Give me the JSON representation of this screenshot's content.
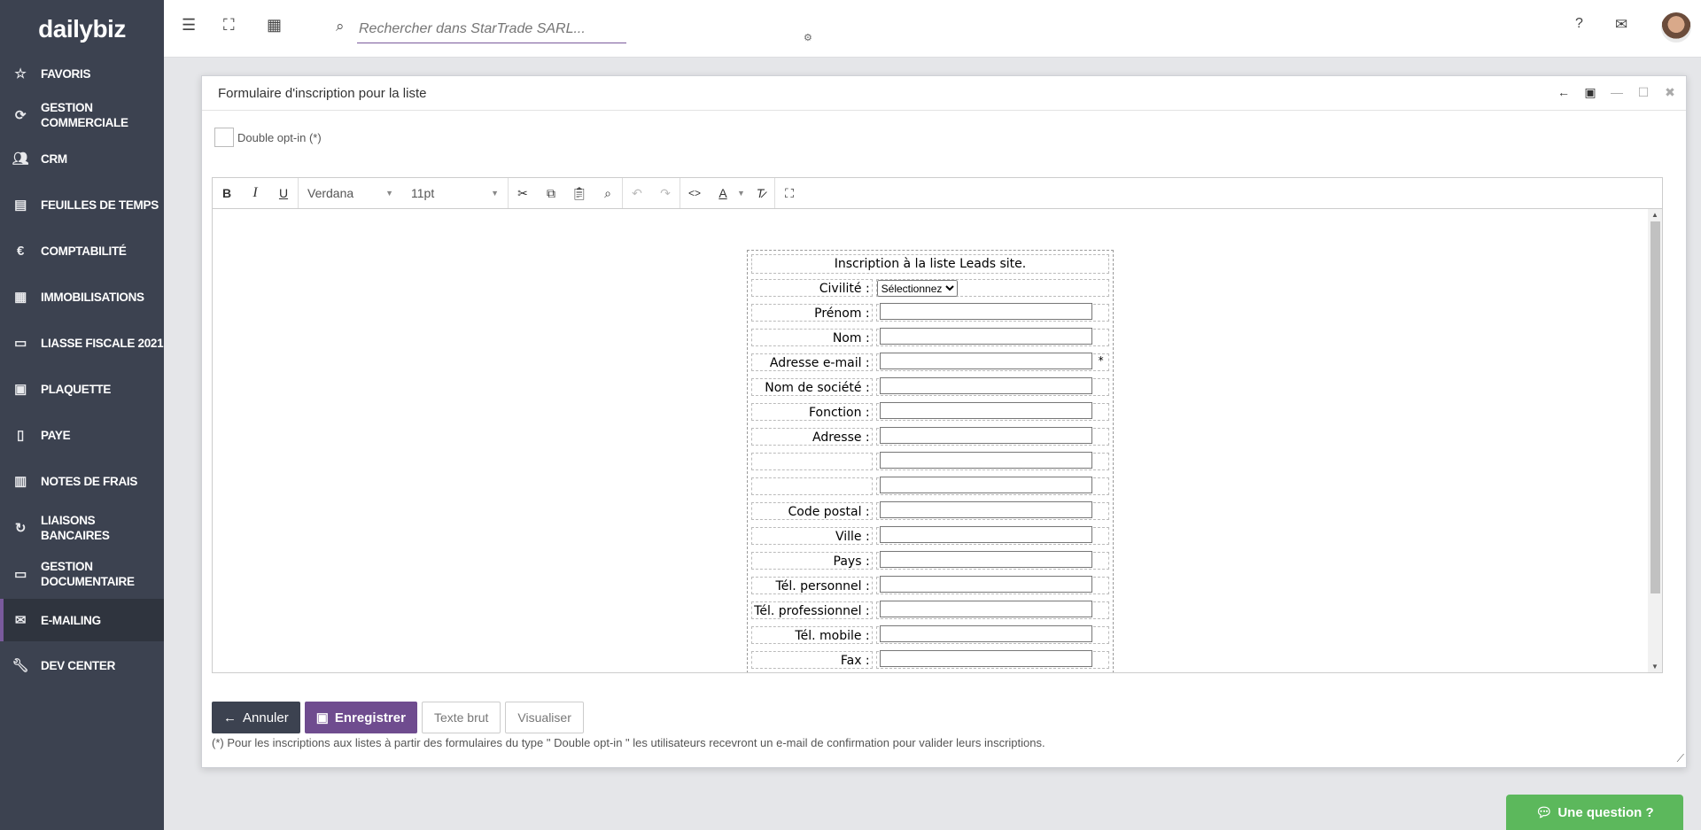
{
  "app": {
    "logo": "dailybiz"
  },
  "sidebar": {
    "items": [
      {
        "label": "FAVORIS",
        "icon": "star-icon"
      },
      {
        "label": "GESTION COMMERCIALE",
        "icon": "sync-icon"
      },
      {
        "label": "CRM",
        "icon": "users-icon"
      },
      {
        "label": "FEUILLES DE TEMPS",
        "icon": "timesheet-icon"
      },
      {
        "label": "COMPTABILITÉ",
        "icon": "euro-icon"
      },
      {
        "label": "IMMOBILISATIONS",
        "icon": "calendar-icon"
      },
      {
        "label": "LIASSE FISCALE 2021",
        "icon": "folder-open-icon"
      },
      {
        "label": "PLAQUETTE",
        "icon": "money-icon"
      },
      {
        "label": "PAYE",
        "icon": "payslip-icon"
      },
      {
        "label": "NOTES DE FRAIS",
        "icon": "receipt-icon"
      },
      {
        "label": "LIAISONS BANCAIRES",
        "icon": "bank-sync-icon"
      },
      {
        "label": "GESTION DOCUMENTAIRE",
        "icon": "folder-icon"
      },
      {
        "label": "E-MAILING",
        "icon": "email-marketing-icon",
        "active": true
      },
      {
        "label": "DEV CENTER",
        "icon": "wrench-icon"
      }
    ]
  },
  "topbar": {
    "search_placeholder": "Rechercher dans StarTrade SARL...",
    "help": "?",
    "mail_icon": "envelope-icon"
  },
  "modal": {
    "title": "Formulaire d'inscription pour la liste",
    "double_optin_label": "Double opt-in (*)",
    "double_optin_checked": false,
    "editor": {
      "font": "Verdana",
      "size": "11pt"
    },
    "form": {
      "title": "Inscription à la liste Leads site.",
      "civilite_label": "Civilité :",
      "civilite_value": "Sélectionnez",
      "fields": [
        {
          "label": "Prénom :"
        },
        {
          "label": "Nom :"
        },
        {
          "label": "Adresse e-mail :",
          "required": "*"
        },
        {
          "label": "Nom de société :"
        },
        {
          "label": "Fonction :"
        },
        {
          "label": "Adresse :"
        },
        {
          "label": ""
        },
        {
          "label": ""
        },
        {
          "label": "Code postal :"
        },
        {
          "label": "Ville :"
        },
        {
          "label": "Pays :"
        },
        {
          "label": "Tél. personnel :"
        },
        {
          "label": "Tél. professionnel :"
        },
        {
          "label": "Tél. mobile :"
        },
        {
          "label": "Fax :"
        }
      ]
    },
    "buttons": {
      "cancel": "Annuler",
      "save": "Enregistrer",
      "raw_text": "Texte brut",
      "preview": "Visualiser"
    },
    "note": "(*) Pour les inscriptions aux listes à partir des formulaires du type \" Double opt-in \" les utilisateurs recevront un e-mail de confirmation pour valider leurs inscriptions."
  },
  "chat": {
    "label": "Une question ?"
  },
  "colors": {
    "sidebar": "#3c4250",
    "accent": "#6f4c8f",
    "chat": "#5cb85c"
  }
}
